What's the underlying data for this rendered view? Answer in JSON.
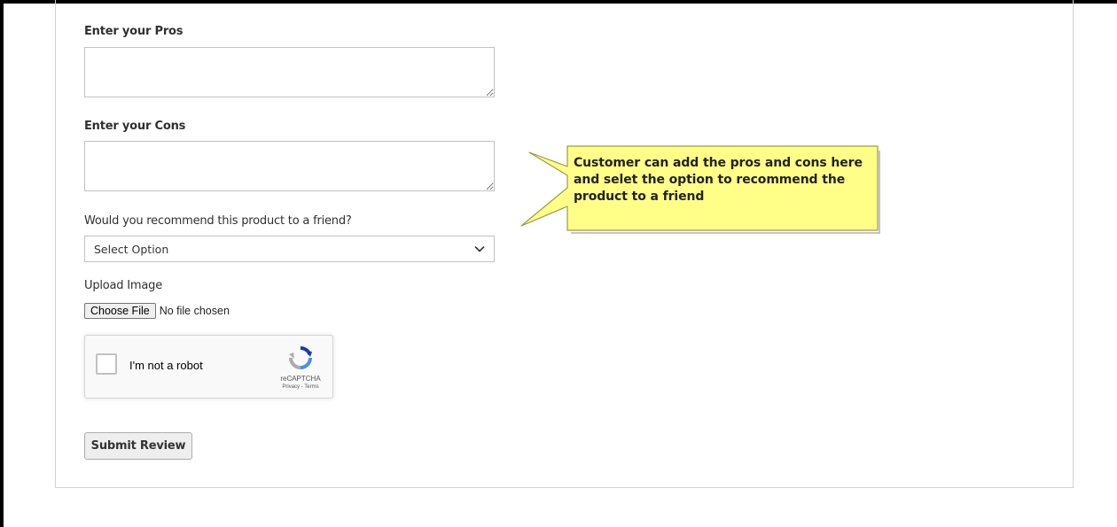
{
  "form": {
    "pros_label": "Enter your Pros",
    "pros_value": "",
    "cons_label": "Enter your Cons",
    "cons_value": "",
    "recommend_label": "Would you recommend this product to a friend?",
    "recommend_selected": "Select Option",
    "upload_label": "Upload Image",
    "file_button": "Choose File",
    "file_status": "No file chosen",
    "captcha_label": "I'm not a robot",
    "captcha_brand": "reCAPTCHA",
    "captcha_links": "Privacy - Terms",
    "submit_label": "Submit Review"
  },
  "callout": {
    "text": "Customer can add the pros and cons here and selet the option to recommend the product to a friend",
    "fill_color": "#ffff88",
    "border_color": "#9a9a4a"
  },
  "icons": {
    "select_arrow": "chevron-down-icon",
    "captcha_logo": "recaptcha-logo-icon"
  }
}
